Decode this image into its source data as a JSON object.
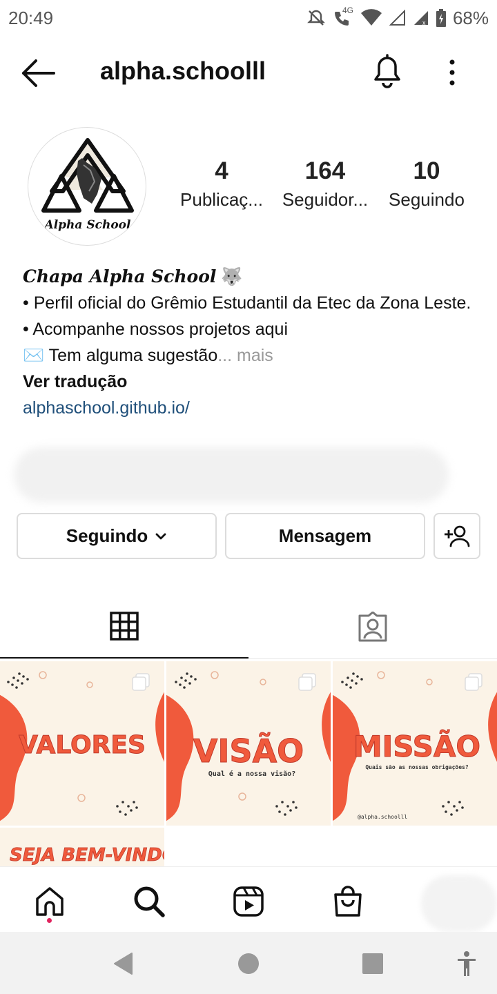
{
  "status_bar": {
    "time": "20:49",
    "network": "4G",
    "battery": "68%"
  },
  "header": {
    "username": "alpha.schoolll"
  },
  "profile": {
    "avatar_text": "Alpha School",
    "stats": [
      {
        "value": "4",
        "label": "Publicaç..."
      },
      {
        "value": "164",
        "label": "Seguidor..."
      },
      {
        "value": "10",
        "label": "Seguindo"
      }
    ],
    "bio": {
      "full_name": "Chapa Alpha School",
      "full_name_emoji": "🐺",
      "line1": "• Perfil oficial do Grêmio Estudantil da Etec da Zona Leste.",
      "line2": "• Acompanhe nossos projetos aqui",
      "line3_emoji": "✉️",
      "line3": "Tem alguma sugestão",
      "more": "... mais",
      "translate": "Ver tradução",
      "link": "alphaschool.github.io/"
    }
  },
  "actions": {
    "following": "Seguindo",
    "message": "Mensagem"
  },
  "posts": [
    {
      "title": "VALORES",
      "subtitle": ""
    },
    {
      "title": "VISÃO",
      "subtitle": "Qual é a nossa visão?"
    },
    {
      "title": "MISSÃO",
      "subtitle": "Quais são as nossas obrigações?",
      "handle": "@alpha.schoolll"
    },
    {
      "title": "SEJA BEM-VINDO!",
      "subtitle": ""
    }
  ],
  "colors": {
    "accent_red": "#f05a3c",
    "cream": "#fbf3e7",
    "link": "#1f4f7a",
    "notification_dot": "#e0245e"
  }
}
